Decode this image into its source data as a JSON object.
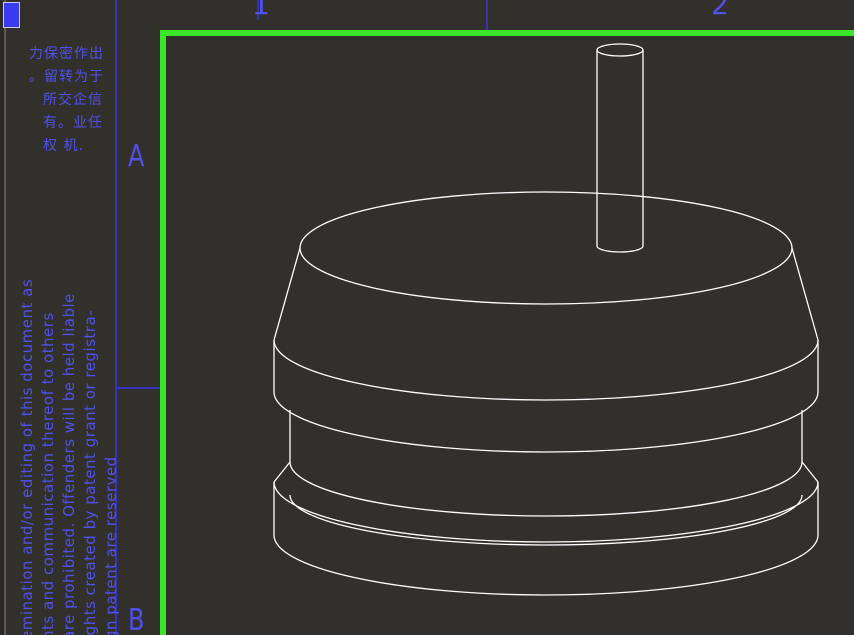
{
  "drawing": {
    "zone_letters": [
      "A",
      "B"
    ],
    "zone_numbers": [
      "1",
      "2"
    ],
    "chinese_notice": {
      "lines": [
        "力保密作出",
        "。留转为于",
        "所交企信",
        "有。业任",
        "权 机."
      ]
    },
    "copyright_notice": {
      "lines": [
        "emination and/or editing of this document as",
        "nts and communication thereof to others",
        "are prohibited. Offenders will be held liable",
        "ights created by patent grant or registra-",
        "gn patent are reserved"
      ]
    }
  },
  "colors": {
    "background": "#32302b",
    "frame_green": "#39e62a",
    "border_blue": "#3434ee",
    "text_blue": "#5050ee",
    "model_lines": "#ffffff"
  }
}
